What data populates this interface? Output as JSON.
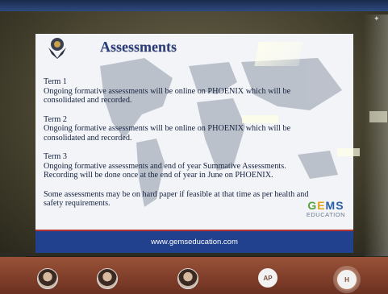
{
  "slide": {
    "title": "Assessments",
    "sections": [
      {
        "heading": "Term 1",
        "body": "Ongoing formative assessments will be  online on PHOENIX which will be consolidated and recorded."
      },
      {
        "heading": "Term 2",
        "body": "Ongoing formative assessments  will be online on PHOENIX which will be consolidated and recorded."
      },
      {
        "heading": "Term 3",
        "body": "Ongoing formative assessments and end of year Summative Assessments. Recording will be done once at the end of year in June on PHOENIX."
      }
    ],
    "note": "Some assessments may be on hard paper if feasible at that time as per health and safety requirements.",
    "brand": {
      "gems": "GEMS",
      "education": "EDUCATION"
    },
    "footer_url": "www.gemseducation.com"
  },
  "participants": [
    {
      "type": "photo",
      "icon": "participant-avatar"
    },
    {
      "type": "photo",
      "icon": "participant-avatar"
    },
    {
      "type": "photo",
      "icon": "participant-avatar"
    },
    {
      "type": "initials",
      "initials": "AP"
    },
    {
      "type": "initials",
      "initials": "H"
    }
  ],
  "colors": {
    "slide_title": "#2a3c78",
    "footer": "#21418e",
    "participant_bar": "#8a4530"
  }
}
